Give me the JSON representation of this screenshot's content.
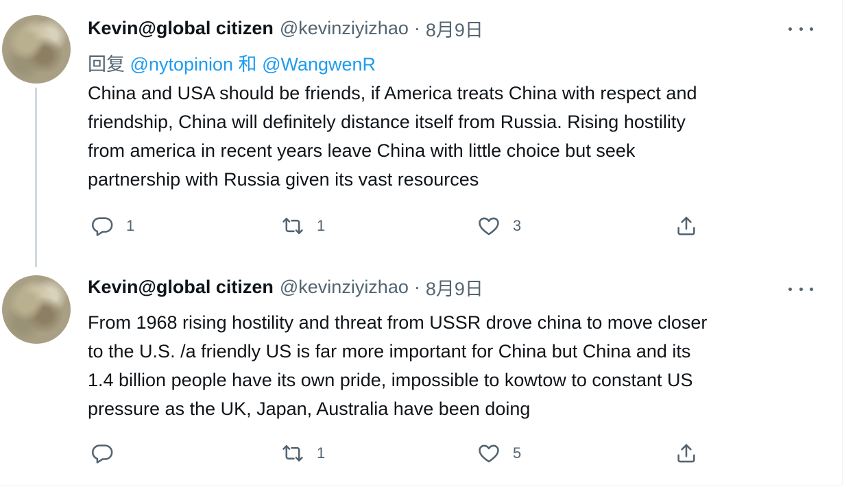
{
  "tweets": [
    {
      "display_name": "Kevin@global citizen",
      "handle": "@kevinziyizhao",
      "separator": "·",
      "date": "8月9日",
      "reply_prefix": "回复",
      "reply_mention_1": "@nytopinion",
      "reply_and": "和",
      "reply_mention_2": "@WangwenR",
      "text": "China and USA should be friends, if America treats China with respect and\nfriendship, China will definitely distance itself from Russia. Rising hostility\nfrom america in recent years leave China with little choice but seek\npartnership with Russia given its vast resources",
      "reply_count": "1",
      "retweet_count": "1",
      "like_count": "3"
    },
    {
      "display_name": "Kevin@global citizen",
      "handle": "@kevinziyizhao",
      "separator": "·",
      "date": "8月9日",
      "text": "From 1968 rising hostility and threat from USSR drove china to move closer\nto the U.S. /a friendly US is far more important for China but China and its\n1.4 billion people have its own pride, impossible to kowtow to constant US\npressure as the UK, Japan, Australia have been doing",
      "reply_count": "",
      "retweet_count": "1",
      "like_count": "5"
    }
  ],
  "icons": {
    "reply": "reply-icon",
    "retweet": "retweet-icon",
    "like": "heart-icon",
    "share": "share-icon",
    "more": "more-icon"
  },
  "colors": {
    "text": "#0f1419",
    "secondary": "#536471",
    "link": "#1d9bf0",
    "thread_line": "#cfd9de"
  }
}
